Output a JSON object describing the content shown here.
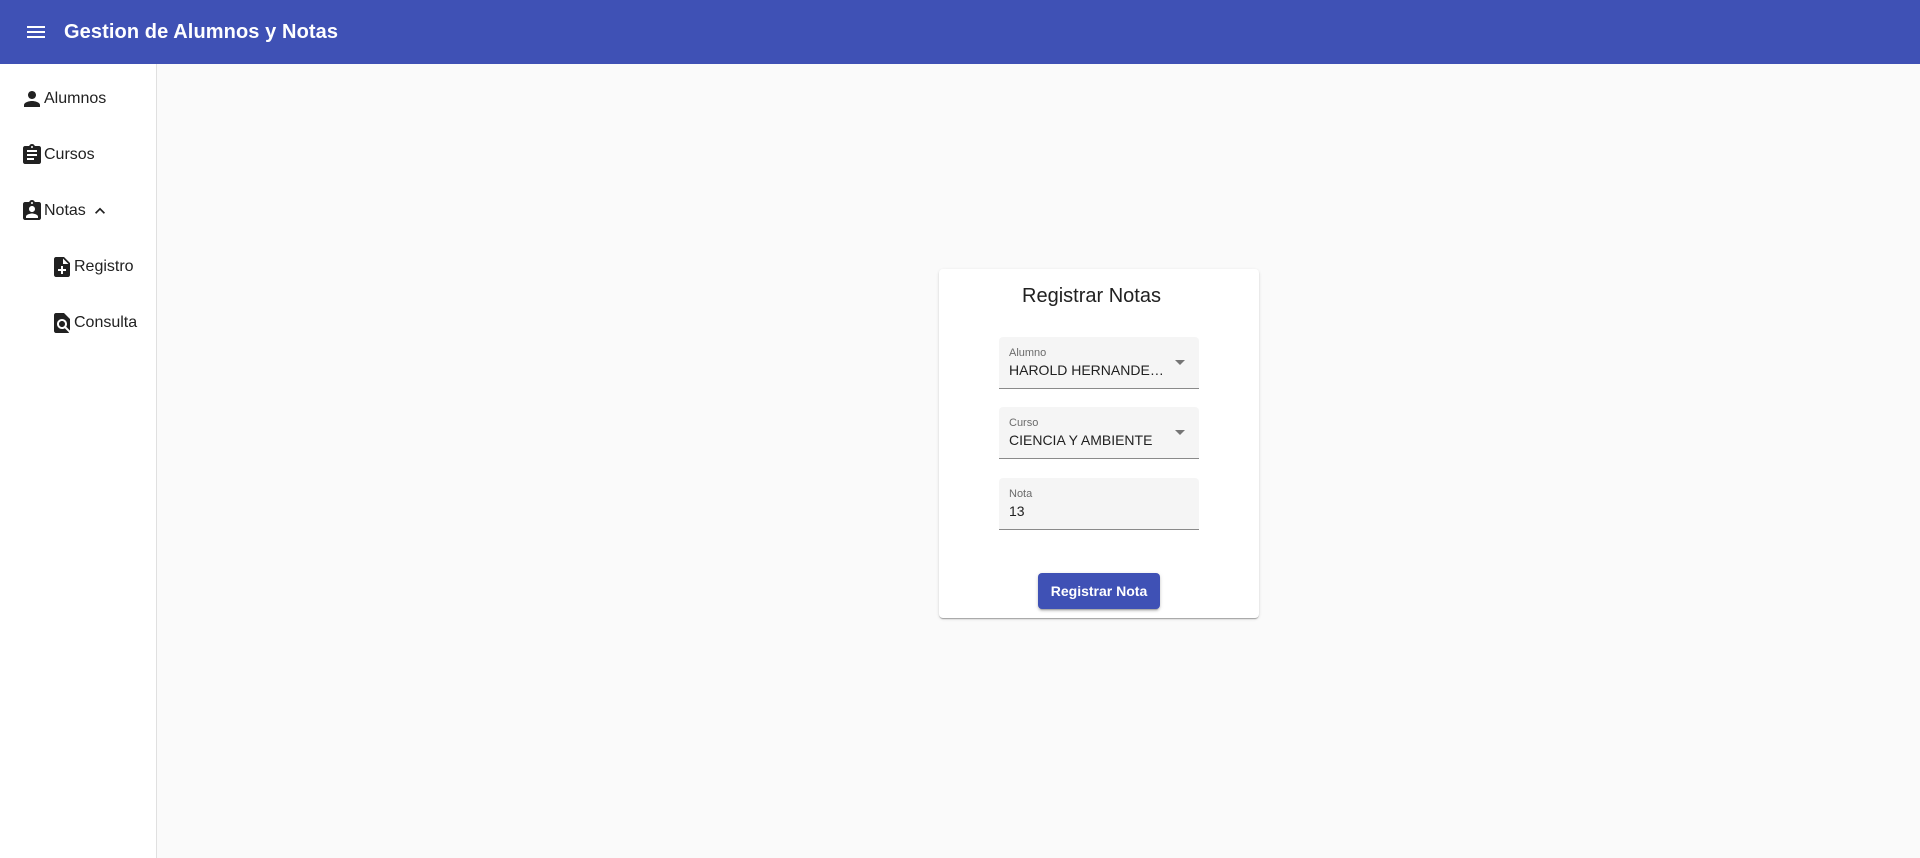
{
  "app": {
    "title": "Gestion de Alumnos y Notas",
    "menu_icon": "menu-icon"
  },
  "sidebar": {
    "items": [
      {
        "label": "Alumnos",
        "icon": "person-icon"
      },
      {
        "label": "Cursos",
        "icon": "assignment-icon"
      },
      {
        "label": "Notas",
        "icon": "assignment-ind-icon",
        "expanded": true,
        "chevron": "chevron-up-icon"
      },
      {
        "label": "Registro",
        "icon": "note-add-icon"
      },
      {
        "label": "Consulta",
        "icon": "find-in-page-icon"
      }
    ]
  },
  "form": {
    "title": "Registrar Notas",
    "alumno": {
      "label": "Alumno",
      "value": "HAROLD HERNANDEZ B..."
    },
    "curso": {
      "label": "Curso",
      "value": "CIENCIA Y AMBIENTE"
    },
    "nota": {
      "label": "Nota",
      "value": "13"
    },
    "submit_label": "Registrar Nota"
  },
  "colors": {
    "primary": "#3f51b5",
    "background": "#fafafa",
    "card": "#ffffff"
  }
}
